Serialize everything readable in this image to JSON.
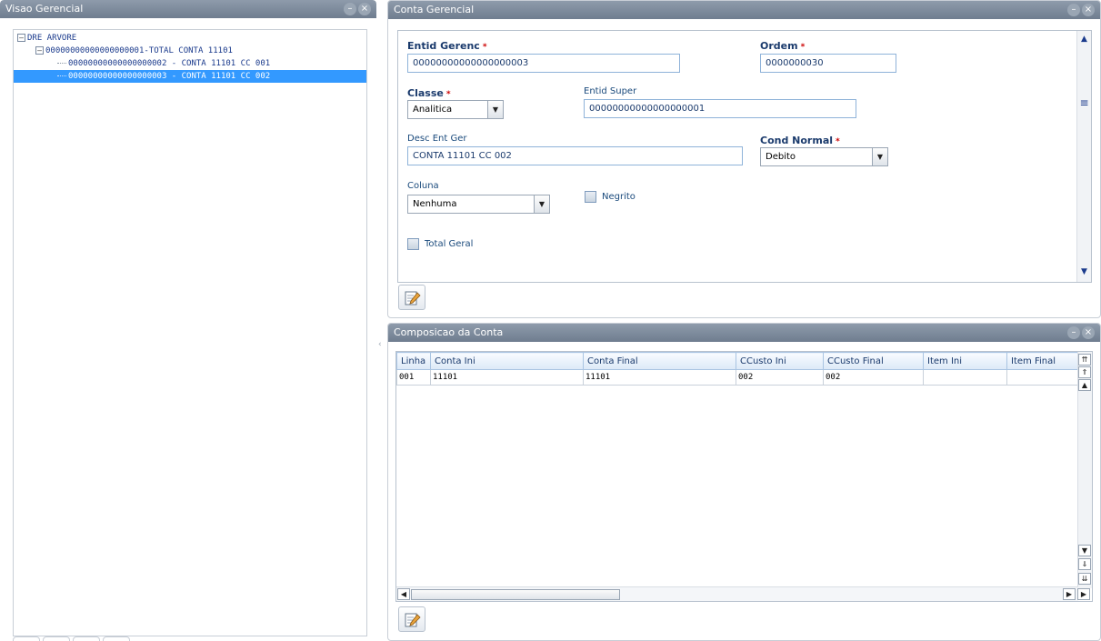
{
  "left_panel": {
    "title": "Visao Gerencial",
    "controls": {
      "minimize": "–",
      "close": "×"
    },
    "tree": [
      {
        "label": "DRE ARVORE",
        "expander": "–",
        "level": 0
      },
      {
        "label": "00000000000000000001-TOTAL CONTA 11101",
        "expander": "–",
        "level": 1
      },
      {
        "label": "00000000000000000002 - CONTA 11101 CC 001",
        "level": 2
      },
      {
        "label": "00000000000000000003 - CONTA 11101 CC 002",
        "level": 2,
        "selected": true
      }
    ]
  },
  "conta_gerencial": {
    "title": "Conta Gerencial",
    "controls": {
      "minimize": "–",
      "close": "×"
    },
    "fields": {
      "entid_gerenc": {
        "label": "Entid Gerenc",
        "value": "00000000000000000003",
        "required": "*"
      },
      "ordem": {
        "label": "Ordem",
        "value": "0000000030",
        "required": "*"
      },
      "classe": {
        "label": "Classe",
        "value": "Analitica",
        "required": "*"
      },
      "entid_super": {
        "label": "Entid Super",
        "value": "00000000000000000001"
      },
      "desc_ent_ger": {
        "label": "Desc Ent Ger",
        "value": "CONTA 11101 CC 002"
      },
      "cond_normal": {
        "label": "Cond Normal",
        "value": "Debito",
        "required": "*"
      },
      "coluna": {
        "label": "Coluna",
        "value": "Nenhuma"
      },
      "negrito": {
        "label": "Negrito"
      },
      "total_geral": {
        "label": "Total Geral"
      }
    },
    "scroll": {
      "up": "▲",
      "middle": "≡",
      "down": "▼"
    }
  },
  "composicao": {
    "title": "Composicao da Conta",
    "controls": {
      "minimize": "–",
      "close": "×"
    },
    "columns": [
      "Linha",
      "Conta Ini",
      "Conta Final",
      "CCusto Ini",
      "CCusto Final",
      "Item Ini",
      "Item Final"
    ],
    "rows": [
      [
        "001",
        "11101",
        "11101",
        "002",
        "002",
        "",
        ""
      ]
    ],
    "scroll": {
      "top": "⇈",
      "page_up": "⇑",
      "up": "▲",
      "down": "▼",
      "page_down": "⇓",
      "bottom": "⇊",
      "left": "◀",
      "right": "▶",
      "right2": "▶"
    }
  },
  "splitter_arrow": "‹",
  "arrow_glyph": "▼"
}
